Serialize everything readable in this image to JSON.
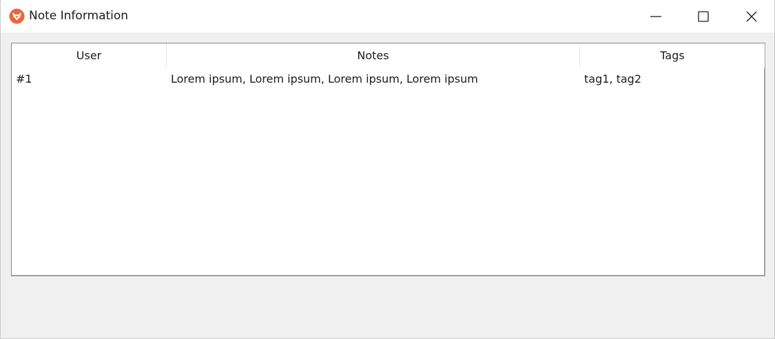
{
  "window": {
    "title": "Note Information",
    "icon": "fox-icon",
    "accent_color": "#e8683a"
  },
  "controls": {
    "minimize": "minimize-icon",
    "maximize": "maximize-icon",
    "close": "close-icon"
  },
  "table": {
    "columns": [
      "User",
      "Notes",
      "Tags"
    ],
    "rows": [
      {
        "user": "#1",
        "notes": "Lorem ipsum, Lorem ipsum, Lorem ipsum, Lorem ipsum",
        "tags": "tag1, tag2"
      }
    ]
  }
}
